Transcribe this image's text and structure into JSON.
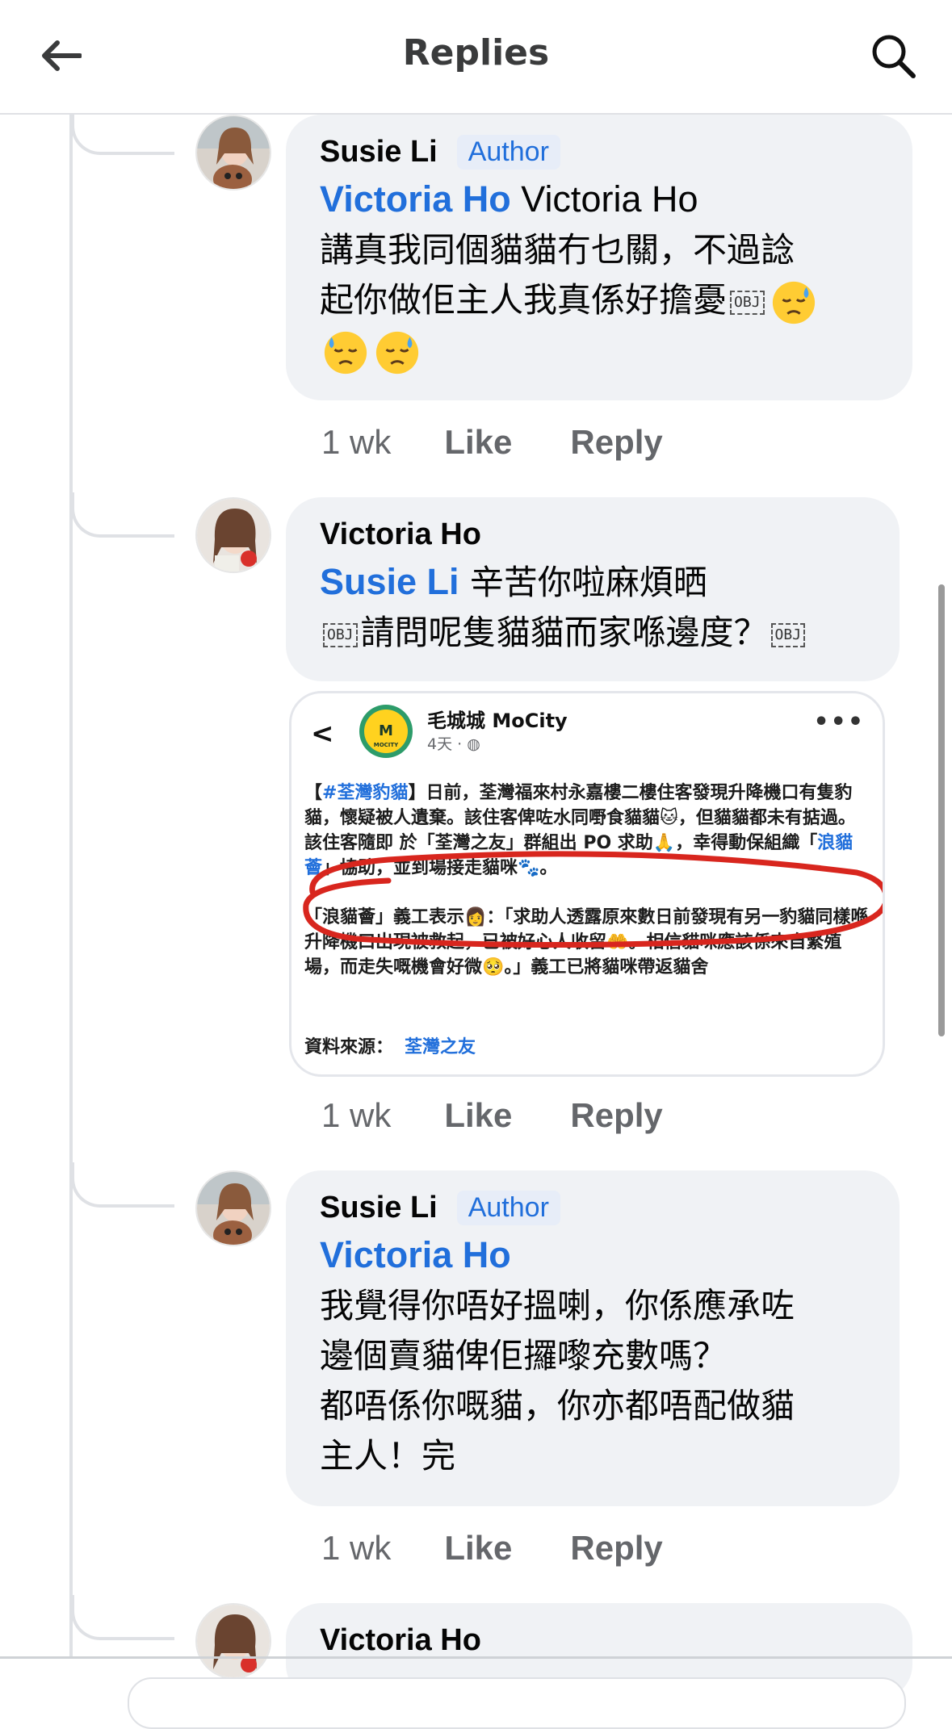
{
  "header": {
    "title": "Replies"
  },
  "comments": [
    {
      "author": "Susie Li",
      "badge": "Author",
      "mention": "Victoria Ho",
      "text_after_mention": " Victoria Ho",
      "line2": "講真我同個貓貓冇乜關，不過諗",
      "line3": "起你做佢主人我真係好擔憂",
      "obj": "OBJ",
      "time": "1 wk",
      "like": "Like",
      "reply": "Reply"
    },
    {
      "author": "Victoria Ho",
      "mention": "Susie Li",
      "text_after_mention": "  辛苦你啦麻煩晒",
      "line2": "請問呢隻貓貓而家喺邊度？",
      "obj": "OBJ",
      "time": "1 wk",
      "like": "Like",
      "reply": "Reply",
      "attachment": {
        "back": "<",
        "page_name": "毛城城 MoCity",
        "logo_text": "MOCITY",
        "time": "4天 ·",
        "more": "•••",
        "p1_tag": "#荃灣豹貓",
        "p1_open": "【",
        "p1_close": "】",
        "p1_text": "日前，荃灣福來村永嘉樓二樓住客發現升降機口有隻豹貓，懷疑被人遺棄。該住客俾咗水同嘢食貓貓🐱，但貓貓都未有掂過。該住客隨即 於「荃灣之友」群組出 PO 求助🙏，幸得動保組織「",
        "p1_link": "浪貓薈",
        "p1_end": "」協助，並到場接走貓咪🐾。",
        "p2_text": "「浪貓薈」義工表示👩：「求助人透露原來數日前發現有另一豹貓同樣喺升降機口出現被救起，已被好心人收留🤲。相信貓咪應該係來自繁殖場，而走失嘅機會好微🥺。」義工已將貓咪帶返貓舍",
        "source_label": "資料來源：",
        "source_link": "荃灣之友"
      }
    },
    {
      "author": "Susie Li",
      "badge": "Author",
      "mention": "Victoria Ho",
      "line2": "我覺得你唔好搵喇，你係應承咗",
      "line3": "邊個賣貓俾佢攞嚟充數嗎？",
      "line4": "都唔係你嘅貓，你亦都唔配做貓",
      "line5": "主人！完",
      "time": "1 wk",
      "like": "Like",
      "reply": "Reply"
    },
    {
      "author": "Victoria Ho"
    }
  ],
  "colors": {
    "accent": "#216fdb",
    "bubble": "#f0f2f5",
    "muted": "#65676b"
  },
  "icons": [
    "back-arrow-icon",
    "search-icon",
    "sweat-face-emoji-icon"
  ]
}
